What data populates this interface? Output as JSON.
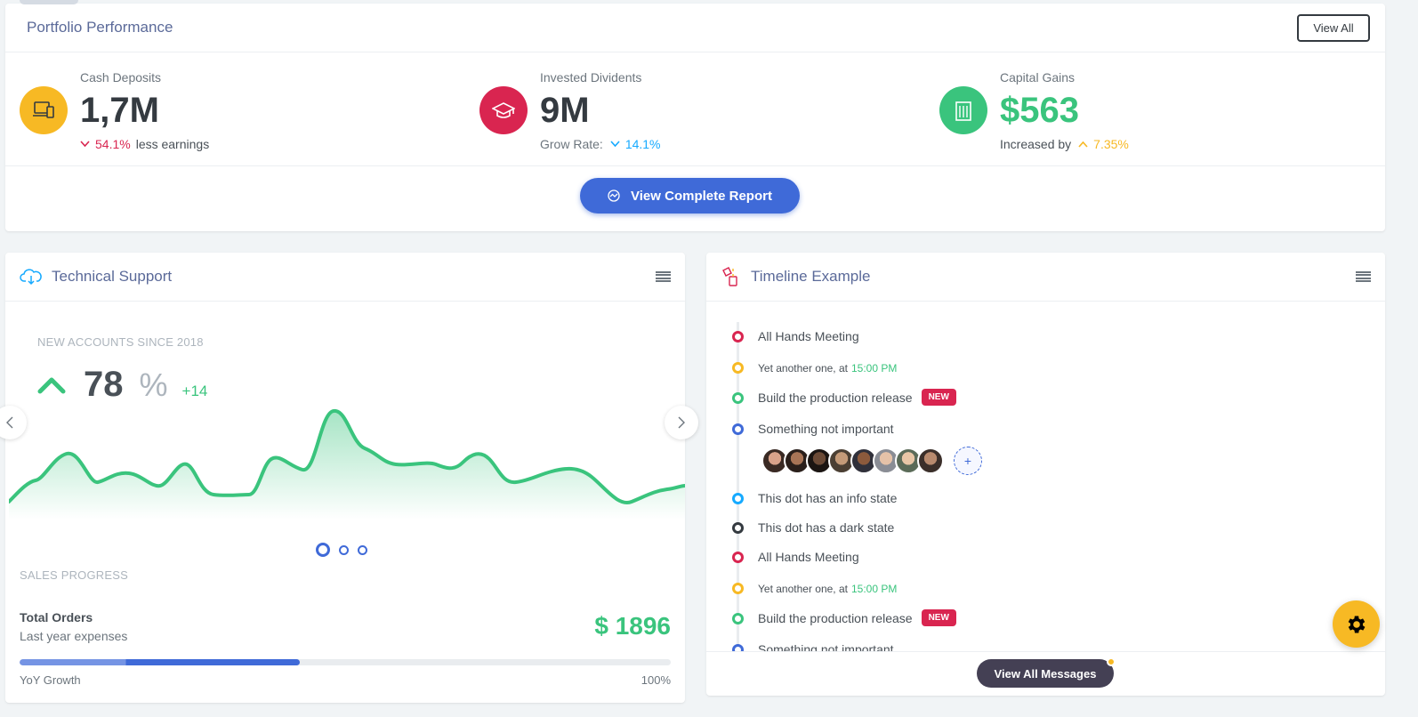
{
  "portfolio": {
    "title": "Portfolio Performance",
    "view_all_label": "View All",
    "widgets": [
      {
        "label": "Cash Deposits",
        "value": "1,7M",
        "pct": "54.1%",
        "desc_after": "less earnings",
        "icon": "laptop-icon",
        "color": "#f7b924"
      },
      {
        "label": "Invested Dividents",
        "value": "9M",
        "desc_before": "Grow Rate:",
        "pct": "14.1%",
        "icon": "graduation-cap-icon",
        "color": "#d92550"
      },
      {
        "label": "Capital Gains",
        "value": "$563",
        "desc_before": "Increased by",
        "pct": "7.35%",
        "icon": "building-icon",
        "color": "#3ac47d"
      }
    ],
    "report_button": "View Complete Report"
  },
  "support": {
    "title": "Technical Support",
    "new_accounts_label": "NEW ACCOUNTS SINCE 2018",
    "value": "78",
    "unit": "%",
    "change": "+14",
    "sales_label": "SALES PROGRESS",
    "orders_title": "Total Orders",
    "orders_sub": "Last year expenses",
    "orders_amount": "$ 1896",
    "progress_fraction": 0.43,
    "yoy_label": "YoY Growth",
    "yoy_pct": "100%",
    "carousel_pages": 3,
    "active_page": 1
  },
  "timeline": {
    "title": "Timeline Example",
    "items": [
      {
        "text": "All Hands Meeting",
        "color": "#d92550"
      },
      {
        "text": "Yet another one, at",
        "time": "15:00 PM",
        "color": "#f7b924"
      },
      {
        "text": "Build the production release",
        "badge": "NEW",
        "color": "#3ac47d"
      },
      {
        "text": "Something not important",
        "color": "#3f6ad8"
      },
      {
        "text": "This dot has an info state",
        "color": "#16aaff"
      },
      {
        "text": "This dot has a dark state",
        "color": "#343a40"
      },
      {
        "text": "All Hands Meeting",
        "color": "#d92550"
      },
      {
        "text": "Yet another one, at",
        "time": "15:00 PM",
        "color": "#f7b924"
      },
      {
        "text": "Build the production release",
        "badge": "NEW",
        "color": "#3ac47d"
      },
      {
        "text": "Something not important",
        "color": "#3f6ad8"
      }
    ],
    "add_label": "+",
    "view_messages_label": "View All Messages"
  },
  "colors": {
    "primary": "#3f6ad8",
    "success": "#3ac47d",
    "warning": "#f7b924",
    "danger": "#d92550",
    "info": "#16aaff",
    "dark": "#343a40"
  }
}
